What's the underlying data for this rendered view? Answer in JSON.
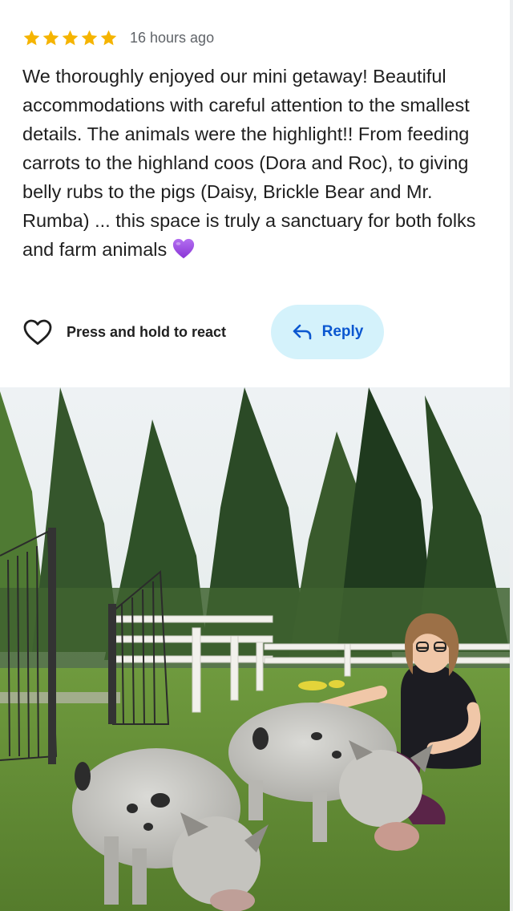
{
  "review": {
    "rating": 5,
    "rating_max": 5,
    "time": "16 hours ago",
    "text": "We thoroughly enjoyed our mini getaway! Beautiful accommodations with careful attention to the smallest details. The animals were the highlight!! From feeding carrots to the highland coos (Dora and Roc), to giving belly rubs to the pigs (Daisy, Brickle Bear and Mr. Rumba) ... this space is truly a sanctuary for both folks and farm animals",
    "emoji": "purple-heart-icon"
  },
  "actions": {
    "react_label": "Press and hold to react",
    "reply_label": "Reply"
  },
  "colors": {
    "star": "#f5b400",
    "reply_bg": "#d4f2fb",
    "reply_text": "#0b57d0",
    "heart_emoji": "#9b4dde"
  }
}
